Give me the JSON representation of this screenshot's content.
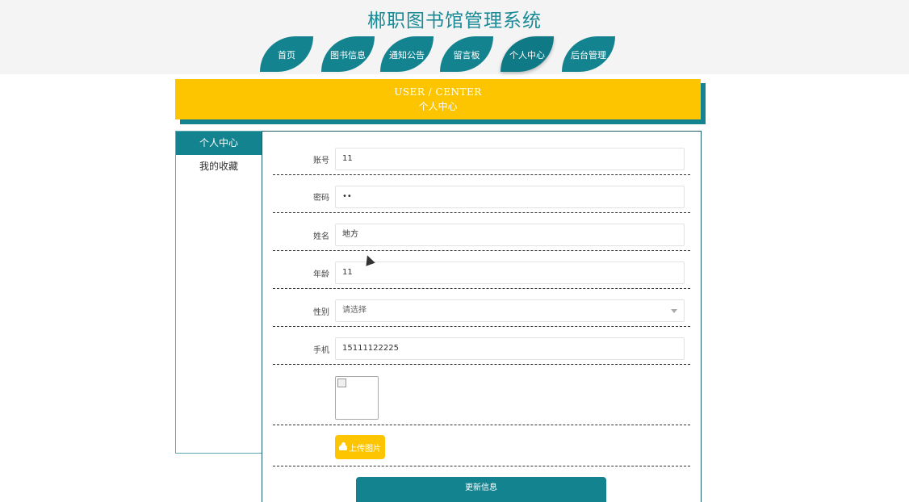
{
  "site_title": "郴职图书馆管理系统",
  "nav": [
    {
      "label": "首页"
    },
    {
      "label": "图书信息"
    },
    {
      "label": "通知公告"
    },
    {
      "label": "留言板"
    },
    {
      "label": "个人中心",
      "active": true
    },
    {
      "label": "后台管理"
    }
  ],
  "banner": {
    "en": "USER / CENTER",
    "cn": "个人中心"
  },
  "sidebar": {
    "items": [
      {
        "label": "个人中心",
        "active": true
      },
      {
        "label": "我的收藏"
      }
    ]
  },
  "form": {
    "account": {
      "label": "账号",
      "value": "11"
    },
    "password": {
      "label": "密码",
      "value": "••"
    },
    "name": {
      "label": "姓名",
      "value": "地方"
    },
    "age": {
      "label": "年龄",
      "value": "11"
    },
    "gender": {
      "label": "性别",
      "selected": "请选择"
    },
    "phone": {
      "label": "手机",
      "value": "15111122225"
    },
    "upload_label": "上传图片",
    "submit_label": "更新信息"
  },
  "colors": {
    "teal": "#12838f",
    "yellow": "#fdc500"
  },
  "icons": [
    "cloud-upload-icon",
    "broken-image-icon",
    "chevron-down-icon",
    "mouse-cursor-icon"
  ]
}
